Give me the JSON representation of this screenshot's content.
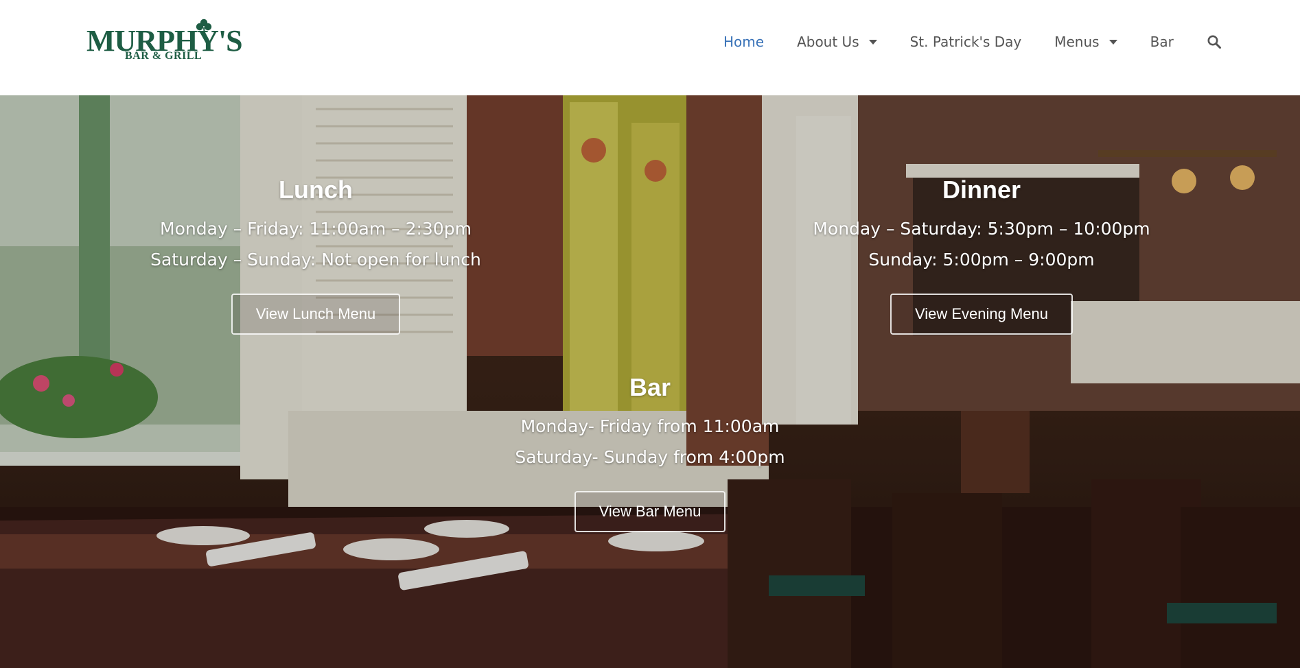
{
  "brand": {
    "logo_main": "MURPHY'S",
    "logo_sub": "BAR & GRILL",
    "color": "#1e5d44"
  },
  "nav": {
    "items": [
      {
        "label": "Home",
        "active": true
      },
      {
        "label": "About Us",
        "dropdown": true
      },
      {
        "label": "St. Patrick's Day"
      },
      {
        "label": "Menus",
        "dropdown": true
      },
      {
        "label": "Bar"
      }
    ],
    "search_icon": "search-icon",
    "active_color": "#3a73b8"
  },
  "hero": {
    "lunch": {
      "title": "Lunch",
      "line1": "Monday – Friday: 11:00am – 2:30pm",
      "line2": "Saturday – Sunday: Not open for lunch",
      "button": "View Lunch Menu"
    },
    "dinner": {
      "title": "Dinner",
      "line1": "Monday – Saturday: 5:30pm – 10:00pm",
      "line2": "Sunday: 5:00pm – 9:00pm",
      "button": "View Evening Menu"
    },
    "bar": {
      "title": "Bar",
      "line1": "Monday- Friday from 11:00am",
      "line2": "Saturday- Sunday from 4:00pm",
      "button": "View Bar Menu"
    }
  }
}
